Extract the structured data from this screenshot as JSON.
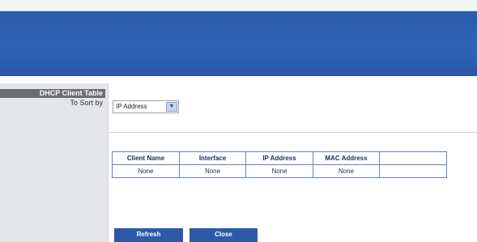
{
  "sidebar": {
    "title": "DHCP Client Table",
    "sort_label": "To Sort by"
  },
  "sort_select": {
    "value": "IP Address"
  },
  "table": {
    "columns": [
      "Client Name",
      "Interface",
      "IP Address",
      "MAC Address",
      ""
    ],
    "rows": [
      [
        "None",
        "None",
        "None",
        "None",
        ""
      ]
    ]
  },
  "buttons": {
    "refresh": "Refresh",
    "close": "Close"
  },
  "colors": {
    "header": "#2f62b6",
    "button": "#2d5aa8",
    "sidebar": "#e4e6e9"
  }
}
